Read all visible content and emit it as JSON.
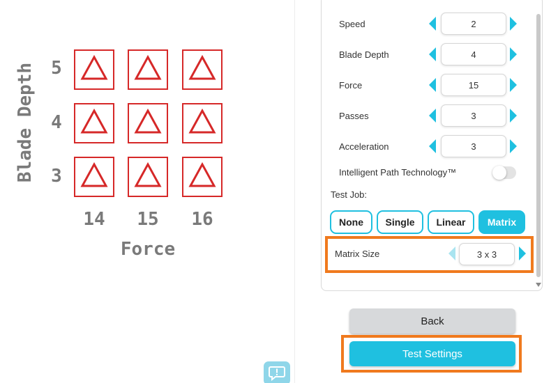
{
  "preview": {
    "y_axis_title": "Blade Depth",
    "x_axis_title": "Force",
    "rows": [
      "5",
      "4",
      "3"
    ],
    "columns": [
      "14",
      "15",
      "16"
    ],
    "cell_icon": "triangle-icon",
    "cell_color": "#d62828"
  },
  "settings": [
    {
      "label": "Speed",
      "value": "2"
    },
    {
      "label": "Blade Depth",
      "value": "4"
    },
    {
      "label": "Force",
      "value": "15"
    },
    {
      "label": "Passes",
      "value": "3"
    },
    {
      "label": "Acceleration",
      "value": "3"
    }
  ],
  "intelligent_path": {
    "label": "Intelligent Path Technology™",
    "enabled": false
  },
  "test_job": {
    "label": "Test Job:",
    "options": [
      "None",
      "Single",
      "Linear",
      "Matrix"
    ],
    "selected": "Matrix"
  },
  "matrix_size": {
    "label": "Matrix Size",
    "value": "3 x 3"
  },
  "buttons": {
    "back": "Back",
    "test_settings": "Test Settings"
  },
  "colors": {
    "accent": "#1fc0e0",
    "highlight": "#f07a1e",
    "back_button": "#d7d9db",
    "matrix_red": "#d62828"
  },
  "icons": [
    "chevron-left-icon",
    "chevron-right-icon",
    "triangle-icon",
    "feedback-icon",
    "scroll-down-icon"
  ]
}
